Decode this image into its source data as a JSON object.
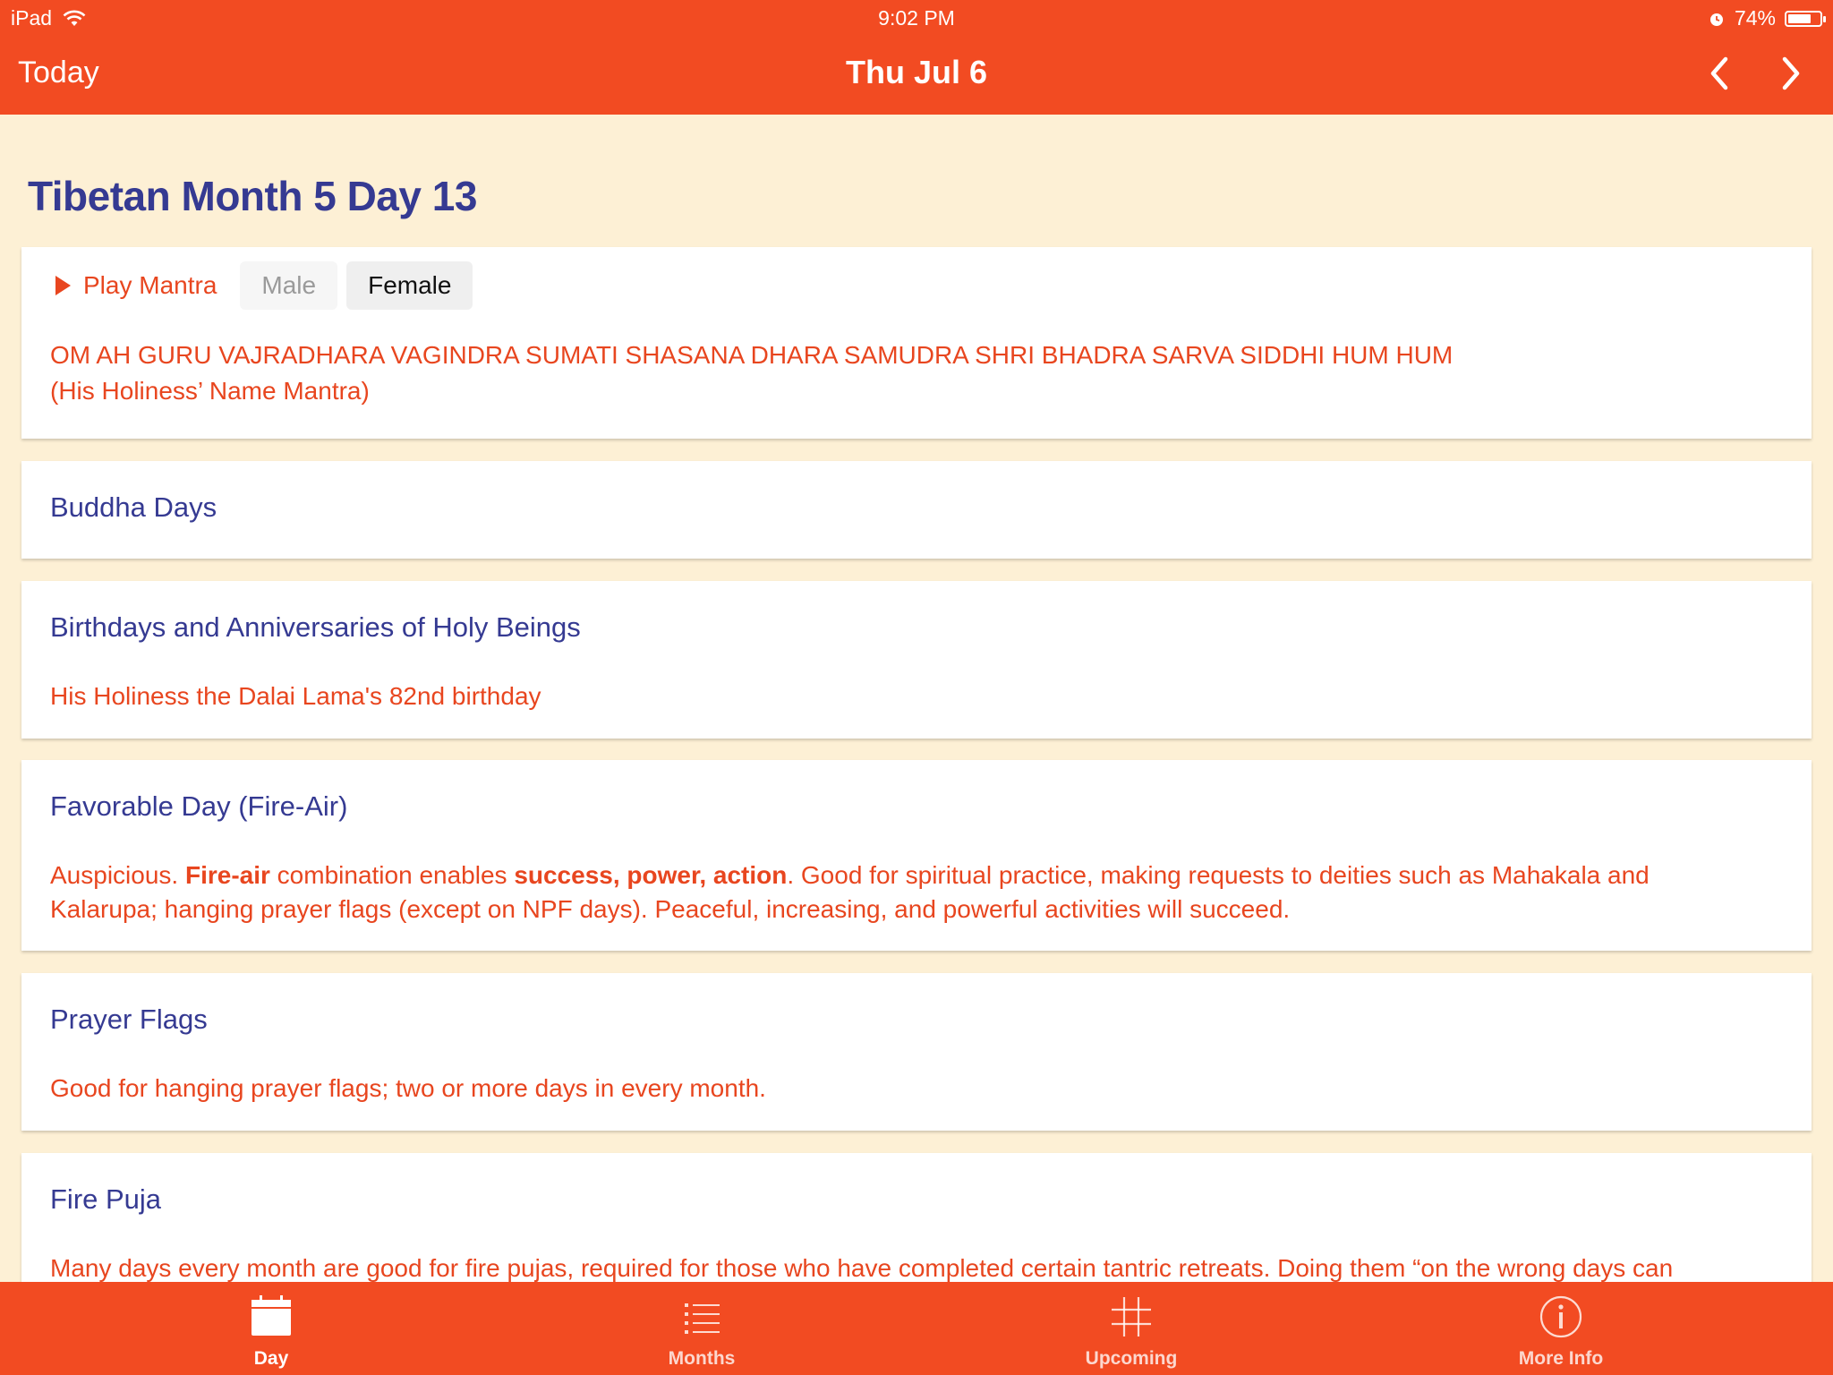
{
  "status": {
    "device": "iPad",
    "time": "9:02 PM",
    "battery": "74%",
    "battery_level": 0.74
  },
  "nav": {
    "today_label": "Today",
    "title": "Thu Jul 6"
  },
  "page": {
    "heading": "Tibetan Month 5 Day 13"
  },
  "mantra": {
    "play_label": "Play Mantra",
    "male_label": "Male",
    "female_label": "Female",
    "selected_voice": "Female",
    "text": "OM AH GURU VAJRADHARA VAGINDRA SUMATI SHASANA DHARA SAMUDRA SHRI BHADRA SARVA SIDDHI HUM HUM",
    "caption": "(His Holiness’ Name Mantra)"
  },
  "sections": {
    "buddha": {
      "title": "Buddha Days"
    },
    "birthdays": {
      "title": "Birthdays and Anniversaries of Holy Beings",
      "body": "His Holiness the Dalai Lama's 82nd birthday"
    },
    "favorable": {
      "title": "Favorable Day (Fire-Air)",
      "body_p1": "Auspicious. ",
      "body_b1": "Fire-air",
      "body_p2": " combination enables ",
      "body_b2": "success, power, action",
      "body_p3": ". Good for spiritual practice, making requests to deities such as Mahakala and Kalarupa; hanging prayer flags (except on NPF days). Peaceful, increasing, and powerful activities will succeed."
    },
    "prayer_flags": {
      "title": "Prayer Flags",
      "body": "Good for hanging prayer flags; two or more days in every month."
    },
    "fire_puja": {
      "title": "Fire Puja",
      "body": "Many days every month are good for fire pujas, required for those who have completed certain tantric retreats. Doing them “on the wrong days can"
    }
  },
  "tabs": [
    {
      "label": "Day",
      "icon": "calendar-icon",
      "active": true
    },
    {
      "label": "Months",
      "icon": "list-icon",
      "active": false
    },
    {
      "label": "Upcoming",
      "icon": "hash-icon",
      "active": false
    },
    {
      "label": "More Info",
      "icon": "info-icon",
      "active": false
    }
  ],
  "colors": {
    "accent": "#f24b22",
    "heading_blue": "#353a92",
    "body_orange": "#e8461f",
    "background": "#fdf0d5"
  }
}
